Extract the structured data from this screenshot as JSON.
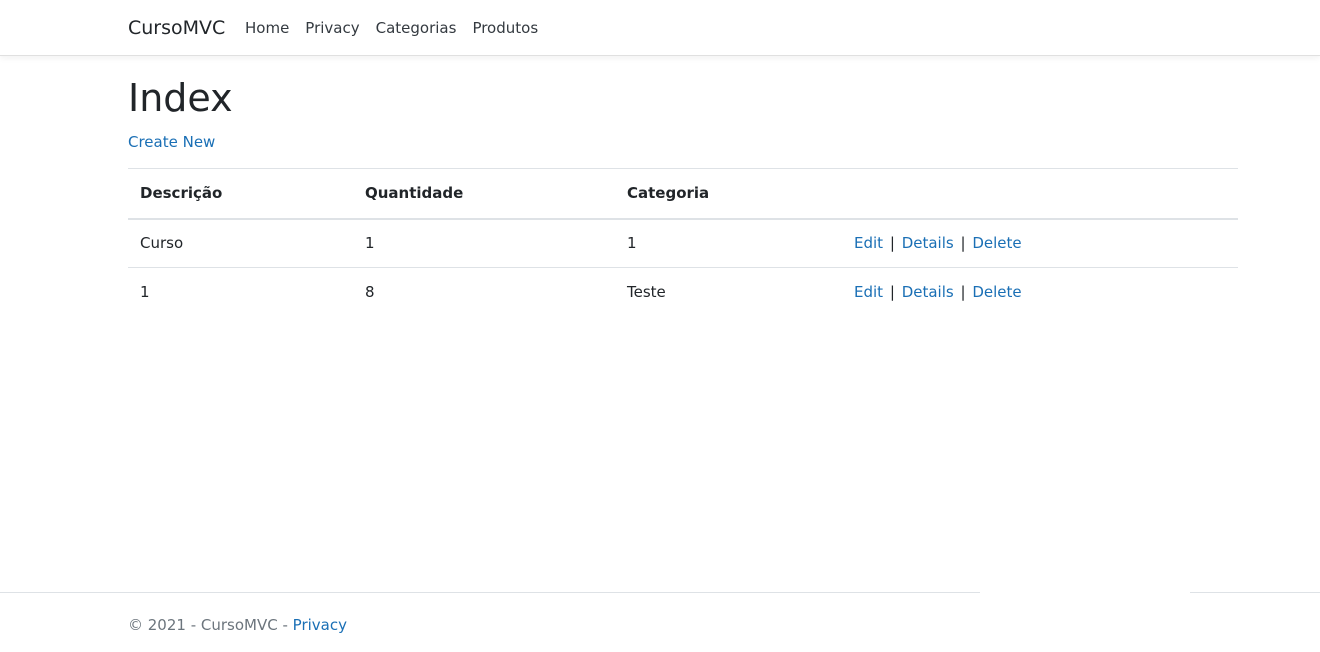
{
  "navbar": {
    "brand": "CursoMVC",
    "links": [
      "Home",
      "Privacy",
      "Categorias",
      "Produtos"
    ]
  },
  "main": {
    "title": "Index",
    "create_link": "Create New",
    "table": {
      "headers": [
        "Descrição",
        "Quantidade",
        "Categoria",
        ""
      ],
      "rows": [
        {
          "descricao": "Curso",
          "quantidade": "1",
          "categoria": "1",
          "actions": [
            "Edit",
            "Details",
            "Delete"
          ]
        },
        {
          "descricao": "1",
          "quantidade": "8",
          "categoria": "Teste",
          "actions": [
            "Edit",
            "Details",
            "Delete"
          ]
        }
      ],
      "separator": "|"
    }
  },
  "footer": {
    "text": "© 2021 - CursoMVC - ",
    "privacy_link": "Privacy"
  },
  "colors": {
    "link": "#1a6fb5",
    "text": "#212529",
    "muted": "#6c757d",
    "border": "#dee2e6"
  }
}
